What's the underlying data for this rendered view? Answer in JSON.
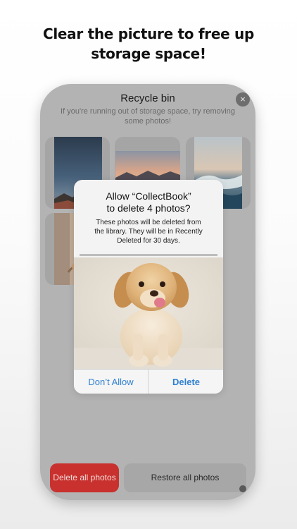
{
  "headline": {
    "line1": "Clear the picture to free up",
    "line2": "storage space!"
  },
  "recycle_bin": {
    "title": "Recycle bin",
    "subtitle_line1": "If you're running out of storage space, try removing",
    "subtitle_line2": "some photos!",
    "close_icon": "×",
    "photos": [
      {
        "subject": "starry-mountain-sky"
      },
      {
        "subject": "sunset-mountain-range"
      },
      {
        "subject": "ocean-wave"
      },
      {
        "subject": "flower-interior"
      }
    ],
    "delete_all_label": "Delete all photos",
    "restore_all_label": "Restore all photos"
  },
  "alert": {
    "title_line1": "Allow “CollectBook”",
    "title_line2": "to delete 4 photos?",
    "message_line1": "These photos will be deleted from",
    "message_line2": "the library. They will be in Recently",
    "message_line3": "Deleted for 30 days.",
    "photo_subject": "golden-retriever-puppy",
    "dont_allow_label": "Don’t Allow",
    "delete_label": "Delete"
  },
  "colors": {
    "delete_red": "#c8312d",
    "ios_blue": "#2f7fd1",
    "overlay_gray": "#b3b3b3"
  }
}
